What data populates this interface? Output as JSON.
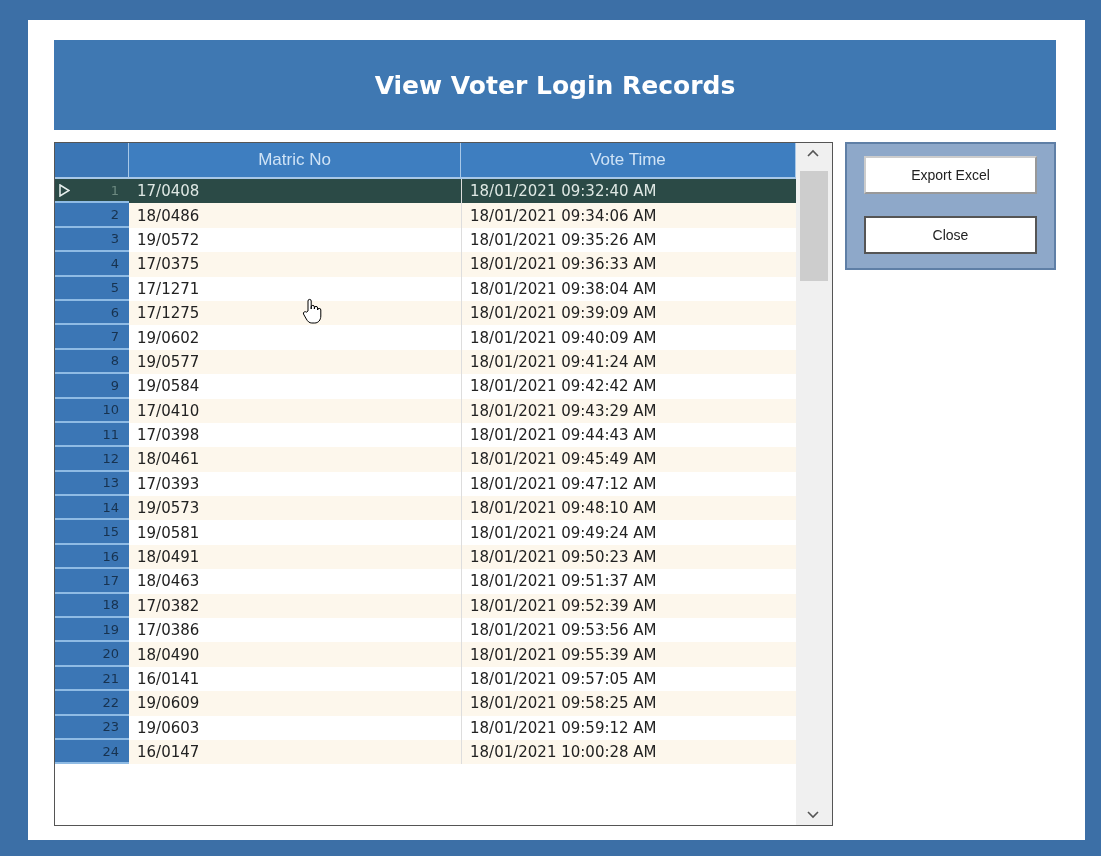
{
  "window": {
    "title": "View Voter Login Records"
  },
  "table": {
    "columns": [
      "Matric No",
      "Vote Time"
    ],
    "rows": [
      {
        "number": "1",
        "matric_no": "17/0408",
        "vote_time": "18/01/2021 09:32:40 AM",
        "selected": true
      },
      {
        "number": "2",
        "matric_no": "18/0486",
        "vote_time": "18/01/2021 09:34:06 AM",
        "selected": false
      },
      {
        "number": "3",
        "matric_no": "19/0572",
        "vote_time": "18/01/2021 09:35:26 AM",
        "selected": false
      },
      {
        "number": "4",
        "matric_no": "17/0375",
        "vote_time": "18/01/2021 09:36:33 AM",
        "selected": false
      },
      {
        "number": "5",
        "matric_no": "17/1271",
        "vote_time": "18/01/2021 09:38:04 AM",
        "selected": false
      },
      {
        "number": "6",
        "matric_no": "17/1275",
        "vote_time": "18/01/2021 09:39:09 AM",
        "selected": false
      },
      {
        "number": "7",
        "matric_no": "19/0602",
        "vote_time": "18/01/2021 09:40:09 AM",
        "selected": false
      },
      {
        "number": "8",
        "matric_no": "19/0577",
        "vote_time": "18/01/2021 09:41:24 AM",
        "selected": false
      },
      {
        "number": "9",
        "matric_no": "19/0584",
        "vote_time": "18/01/2021 09:42:42 AM",
        "selected": false
      },
      {
        "number": "10",
        "matric_no": "17/0410",
        "vote_time": "18/01/2021 09:43:29 AM",
        "selected": false
      },
      {
        "number": "11",
        "matric_no": "17/0398",
        "vote_time": "18/01/2021 09:44:43 AM",
        "selected": false
      },
      {
        "number": "12",
        "matric_no": "18/0461",
        "vote_time": "18/01/2021 09:45:49 AM",
        "selected": false
      },
      {
        "number": "13",
        "matric_no": "17/0393",
        "vote_time": "18/01/2021 09:47:12 AM",
        "selected": false
      },
      {
        "number": "14",
        "matric_no": "19/0573",
        "vote_time": "18/01/2021 09:48:10 AM",
        "selected": false
      },
      {
        "number": "15",
        "matric_no": "19/0581",
        "vote_time": "18/01/2021 09:49:24 AM",
        "selected": false
      },
      {
        "number": "16",
        "matric_no": "18/0491",
        "vote_time": "18/01/2021 09:50:23 AM",
        "selected": false
      },
      {
        "number": "17",
        "matric_no": "18/0463",
        "vote_time": "18/01/2021 09:51:37 AM",
        "selected": false
      },
      {
        "number": "18",
        "matric_no": "17/0382",
        "vote_time": "18/01/2021 09:52:39 AM",
        "selected": false
      },
      {
        "number": "19",
        "matric_no": "17/0386",
        "vote_time": "18/01/2021 09:53:56 AM",
        "selected": false
      },
      {
        "number": "20",
        "matric_no": "18/0490",
        "vote_time": "18/01/2021 09:55:39 AM",
        "selected": false
      },
      {
        "number": "21",
        "matric_no": "16/0141",
        "vote_time": "18/01/2021 09:57:05 AM",
        "selected": false
      },
      {
        "number": "22",
        "matric_no": "19/0609",
        "vote_time": "18/01/2021 09:58:25 AM",
        "selected": false
      },
      {
        "number": "23",
        "matric_no": "19/0603",
        "vote_time": "18/01/2021 09:59:12 AM",
        "selected": false
      },
      {
        "number": "24",
        "matric_no": "16/0147",
        "vote_time": "18/01/2021 10:00:28 AM",
        "selected": false
      }
    ]
  },
  "buttons": [
    "Export Excel",
    "Close"
  ]
}
